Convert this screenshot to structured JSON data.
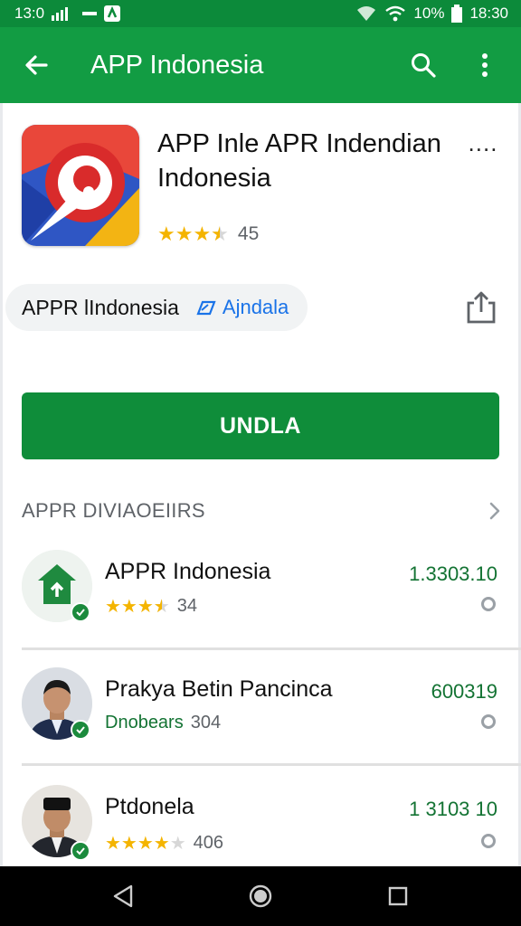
{
  "status": {
    "time_left": "13:0",
    "battery": "10%",
    "time_right": "18:30"
  },
  "app_bar": {
    "title": "APP Indonesia",
    "back_icon": "arrow-back-icon",
    "search_icon": "search-icon",
    "menu_icon": "more-vert-icon"
  },
  "app": {
    "name": "APP Inle APR Indendian Indonesia",
    "more_label": "....",
    "rating": 3.5,
    "rating_count": "45"
  },
  "chip": {
    "label": "APPR lIndonesia",
    "link_label": "Ajndala",
    "link_icon": "edit-icon"
  },
  "install": {
    "label": "UNDLA"
  },
  "section": {
    "title": "APPR DIVIAOEIIRS"
  },
  "items": [
    {
      "name": "APPR Indonesia",
      "rating": 3.5,
      "count": "34",
      "value": "1.3303.10",
      "avatar": "home-icon"
    },
    {
      "name": "Prakya Betin Pancinca",
      "sublabel": "Dnobears",
      "count": "304",
      "value": "600319",
      "avatar": "person-photo"
    },
    {
      "name": "Ptdonela",
      "rating": 4,
      "count": "406",
      "value": "1 3103 10",
      "avatar": "person-photo"
    }
  ],
  "colors": {
    "app_bar": "#129c43",
    "status_bar": "#0c8a3a",
    "install": "#0f8d3a",
    "accent_green": "#137333",
    "star": "#f4b400"
  }
}
